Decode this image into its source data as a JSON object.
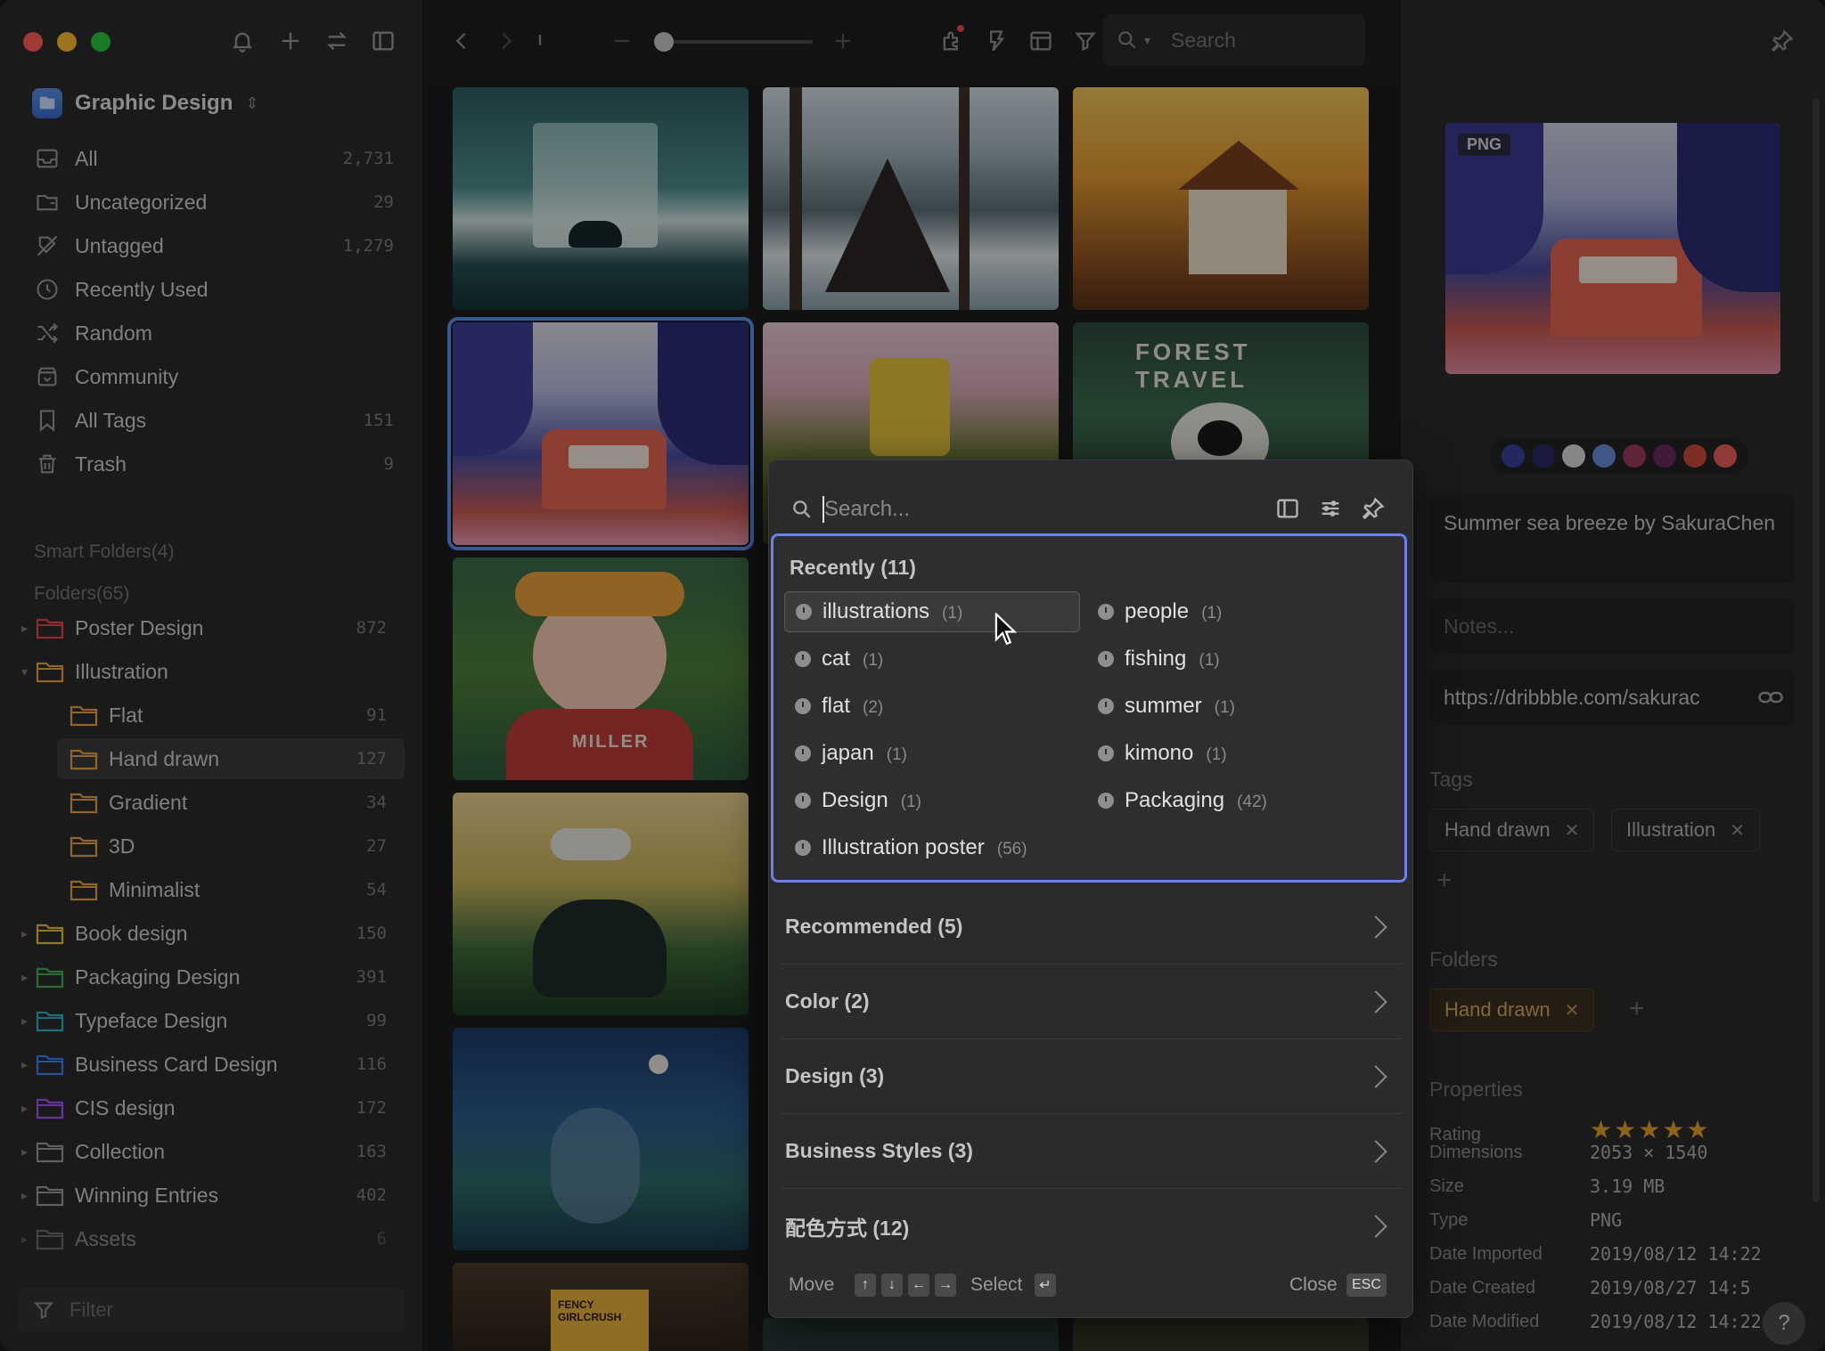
{
  "library": {
    "name": "Graphic Design"
  },
  "sidebar": {
    "items": [
      {
        "label": "All",
        "count": "2,731",
        "icon": "inbox-icon"
      },
      {
        "label": "Uncategorized",
        "count": "29",
        "icon": "folder-question-icon"
      },
      {
        "label": "Untagged",
        "count": "1,279",
        "icon": "tag-off-icon"
      },
      {
        "label": "Recently Used",
        "count": "",
        "icon": "clock-icon"
      },
      {
        "label": "Random",
        "count": "",
        "icon": "shuffle-icon"
      },
      {
        "label": "Community",
        "count": "",
        "icon": "community-icon"
      },
      {
        "label": "All Tags",
        "count": "151",
        "icon": "bookmark-icon"
      },
      {
        "label": "Trash",
        "count": "9",
        "icon": "trash-icon"
      }
    ],
    "smart_folders": "Smart Folders(4)",
    "folders_title": "Folders(65)",
    "folders": [
      {
        "label": "Poster Design",
        "count": "872",
        "color": "#e5484d"
      },
      {
        "label": "Illustration",
        "count": "",
        "color": "#e8a33d"
      },
      {
        "label": "Flat",
        "count": "91",
        "color": "#e8a33d"
      },
      {
        "label": "Hand drawn",
        "count": "127",
        "color": "#e8a33d"
      },
      {
        "label": "Gradient",
        "count": "34",
        "color": "#e8a33d"
      },
      {
        "label": "3D",
        "count": "27",
        "color": "#e8a33d"
      },
      {
        "label": "Minimalist",
        "count": "54",
        "color": "#e8a33d"
      },
      {
        "label": "Book design",
        "count": "150",
        "color": "#e8c23d"
      },
      {
        "label": "Packaging Design",
        "count": "391",
        "color": "#4caf50"
      },
      {
        "label": "Typeface Design",
        "count": "99",
        "color": "#2fb4c6"
      },
      {
        "label": "Business Card Design",
        "count": "116",
        "color": "#3b82f6"
      },
      {
        "label": "CIS design",
        "count": "172",
        "color": "#a855f7"
      },
      {
        "label": "Collection",
        "count": "163",
        "color": "#9a9a9c"
      },
      {
        "label": "Winning Entries",
        "count": "402",
        "color": "#9a9a9c"
      },
      {
        "label": "Assets",
        "count": "6",
        "color": "#9a9a9c"
      }
    ],
    "filter_placeholder": "Filter"
  },
  "toolbar": {
    "search_placeholder": "Search"
  },
  "grid": {
    "forest_travel_label": "FOREST TRAVEL",
    "miller_label": "MILLER",
    "fency_label": "FENCY GIRLCRUSH"
  },
  "inspector": {
    "badge": "PNG",
    "palette": [
      "#3c3f9a",
      "#2a2a6a",
      "#d8d8dc",
      "#6a8ed8",
      "#9a3a5a",
      "#6a2a5a",
      "#c84a3a",
      "#e8605a"
    ],
    "title": "Summer sea breeze by SakuraChen",
    "notes_placeholder": "Notes...",
    "url": "https://dribbble.com/sakurac",
    "tags_label": "Tags",
    "tags": [
      "Hand drawn",
      "Illustration"
    ],
    "folders_label": "Folders",
    "folders": [
      "Hand drawn"
    ],
    "properties_label": "Properties",
    "rating_label": "Rating",
    "rating": 5,
    "props": [
      {
        "k": "Dimensions",
        "v": "2053 × 1540"
      },
      {
        "k": "Size",
        "v": "3.19 MB"
      },
      {
        "k": "Type",
        "v": "PNG"
      },
      {
        "k": "Date Imported",
        "v": "2019/08/12 14:22"
      },
      {
        "k": "Date Created",
        "v": "2019/08/27 14:5"
      },
      {
        "k": "Date Modified",
        "v": "2019/08/12 14:22"
      }
    ]
  },
  "popup": {
    "search_placeholder": "Search...",
    "recent_title": "Recently (11)",
    "recent": [
      {
        "name": "illustrations",
        "count": "(1)"
      },
      {
        "name": "people",
        "count": "(1)"
      },
      {
        "name": "cat",
        "count": "(1)"
      },
      {
        "name": "fishing",
        "count": "(1)"
      },
      {
        "name": "flat",
        "count": "(2)"
      },
      {
        "name": "summer",
        "count": "(1)"
      },
      {
        "name": "japan",
        "count": "(1)"
      },
      {
        "name": "kimono",
        "count": "(1)"
      },
      {
        "name": "Design",
        "count": "(1)"
      },
      {
        "name": "Packaging",
        "count": "(42)"
      },
      {
        "name": "Illustration poster",
        "count": "(56)"
      }
    ],
    "groups": [
      "Recommended (5)",
      "Color (2)",
      "Design (3)",
      "Business Styles (3)",
      "配色方式 (12)"
    ],
    "footer": {
      "move": "Move",
      "select": "Select",
      "close": "Close",
      "esc": "ESC",
      "enter": "↵",
      "up": "↑",
      "down": "↓",
      "left": "←",
      "right": "→"
    }
  },
  "help": "?"
}
